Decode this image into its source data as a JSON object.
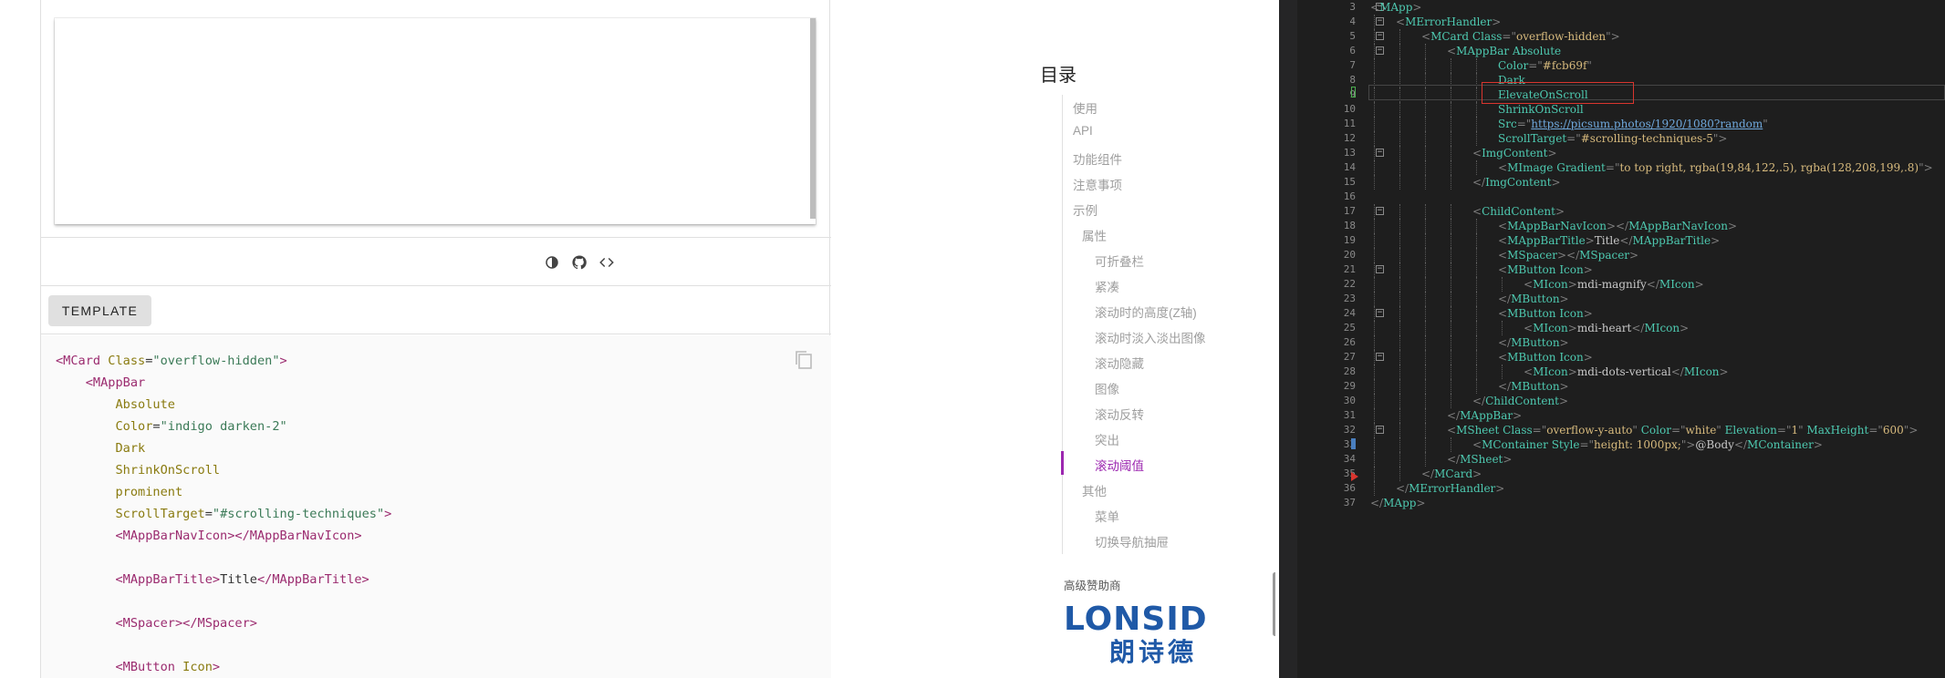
{
  "example": {
    "toolbar_icons": [
      "invert-colors-icon",
      "github-icon",
      "code-icon"
    ],
    "template_tab": "TEMPLATE",
    "code_lines": [
      [
        [
          "t",
          "<MCard "
        ],
        [
          "a",
          "Class"
        ],
        [
          "p",
          "="
        ],
        [
          "s",
          "\"overflow-hidden\""
        ],
        [
          "t",
          ">"
        ]
      ],
      [
        [
          "p",
          "    "
        ],
        [
          "t",
          "<MAppBar"
        ]
      ],
      [
        [
          "p",
          "        "
        ],
        [
          "a",
          "Absolute"
        ]
      ],
      [
        [
          "p",
          "        "
        ],
        [
          "a",
          "Color"
        ],
        [
          "p",
          "="
        ],
        [
          "s",
          "\"indigo darken-2\""
        ]
      ],
      [
        [
          "p",
          "        "
        ],
        [
          "a",
          "Dark"
        ]
      ],
      [
        [
          "p",
          "        "
        ],
        [
          "a",
          "ShrinkOnScroll"
        ]
      ],
      [
        [
          "p",
          "        "
        ],
        [
          "a",
          "prominent"
        ]
      ],
      [
        [
          "p",
          "        "
        ],
        [
          "a",
          "ScrollTarget"
        ],
        [
          "p",
          "="
        ],
        [
          "s",
          "\"#scrolling-techniques\""
        ],
        [
          "t",
          ">"
        ]
      ],
      [
        [
          "p",
          "        "
        ],
        [
          "t",
          "<MAppBarNavIcon></MAppBarNavIcon>"
        ]
      ],
      [
        [
          "p",
          ""
        ]
      ],
      [
        [
          "p",
          "        "
        ],
        [
          "t",
          "<MAppBarTitle>"
        ],
        [
          "p",
          "Title"
        ],
        [
          "t",
          "</MAppBarTitle>"
        ]
      ],
      [
        [
          "p",
          ""
        ]
      ],
      [
        [
          "p",
          "        "
        ],
        [
          "t",
          "<MSpacer></MSpacer>"
        ]
      ],
      [
        [
          "p",
          ""
        ]
      ],
      [
        [
          "p",
          "        "
        ],
        [
          "t",
          "<MButton "
        ],
        [
          "a",
          "Icon"
        ],
        [
          "t",
          ">"
        ]
      ]
    ]
  },
  "toc": {
    "title": "目录",
    "items": [
      {
        "label": "使用",
        "level": 1
      },
      {
        "label": "API",
        "level": 1
      },
      {
        "label": "功能组件",
        "level": 1
      },
      {
        "label": "注意事项",
        "level": 1
      },
      {
        "label": "示例",
        "level": 1
      },
      {
        "label": "属性",
        "level": 2
      },
      {
        "label": "可折叠栏",
        "level": 3
      },
      {
        "label": "紧凑",
        "level": 3
      },
      {
        "label": "滚动时的高度(Z轴)",
        "level": 3
      },
      {
        "label": "滚动时淡入淡出图像",
        "level": 3
      },
      {
        "label": "滚动隐藏",
        "level": 3
      },
      {
        "label": "图像",
        "level": 3
      },
      {
        "label": "滚动反转",
        "level": 3
      },
      {
        "label": "突出",
        "level": 3
      },
      {
        "label": "滚动阈值",
        "level": 3,
        "active": true
      },
      {
        "label": "其他",
        "level": 2
      },
      {
        "label": "菜单",
        "level": 3
      },
      {
        "label": "切换导航抽屉",
        "level": 3
      }
    ],
    "sponsor_label": "高级赞助商",
    "sponsor_logo_text": "LONSID",
    "sponsor_logo_cn": "朗诗德",
    "active_color": "#9c27b0"
  },
  "editor": {
    "line_numbers": [
      3,
      4,
      5,
      6,
      7,
      8,
      9,
      10,
      11,
      12,
      13,
      14,
      15,
      16,
      17,
      18,
      19,
      20,
      21,
      22,
      23,
      24,
      25,
      26,
      27,
      28,
      29,
      30,
      31,
      32,
      33,
      34,
      35,
      36,
      37
    ],
    "fold_lines": [
      3,
      4,
      5,
      6,
      13,
      17,
      21,
      24,
      27,
      32
    ],
    "lines": [
      [
        0,
        [
          [
            "b",
            "<"
          ],
          [
            "t",
            "MApp"
          ],
          [
            "b",
            ">"
          ]
        ]
      ],
      [
        1,
        [
          [
            "b",
            "<"
          ],
          [
            "t",
            "MErrorHandler"
          ],
          [
            "b",
            ">"
          ]
        ]
      ],
      [
        2,
        [
          [
            "b",
            "<"
          ],
          [
            "t",
            "MCard "
          ],
          [
            "at",
            "Class"
          ],
          [
            "b",
            "=\""
          ],
          [
            "x",
            "overflow-hidden"
          ],
          [
            "b",
            "\">"
          ]
        ]
      ],
      [
        3,
        [
          [
            "b",
            "<"
          ],
          [
            "t",
            "MAppBar "
          ],
          [
            "at",
            "Absolute"
          ]
        ]
      ],
      [
        5,
        [
          [
            "at",
            "Color"
          ],
          [
            "b",
            "=\""
          ],
          [
            "x",
            "#fcb69f"
          ],
          [
            "b",
            "\""
          ]
        ]
      ],
      [
        5,
        [
          [
            "at",
            "Dark"
          ]
        ]
      ],
      [
        5,
        [
          [
            "at",
            "ElevateOnScroll"
          ]
        ]
      ],
      [
        5,
        [
          [
            "at",
            "ShrinkOnScroll"
          ]
        ]
      ],
      [
        5,
        [
          [
            "at",
            "Src"
          ],
          [
            "b",
            "=\""
          ],
          [
            "u",
            "https://picsum.photos/1920/1080?random"
          ],
          [
            "b",
            "\""
          ]
        ]
      ],
      [
        5,
        [
          [
            "at",
            "ScrollTarget"
          ],
          [
            "b",
            "=\""
          ],
          [
            "x",
            "#scrolling-techniques-5"
          ],
          [
            "b",
            "\">"
          ]
        ]
      ],
      [
        4,
        [
          [
            "b",
            "<"
          ],
          [
            "t",
            "ImgContent"
          ],
          [
            "b",
            ">"
          ]
        ]
      ],
      [
        5,
        [
          [
            "b",
            "<"
          ],
          [
            "t",
            "MImage "
          ],
          [
            "at",
            "Gradient"
          ],
          [
            "b",
            "=\""
          ],
          [
            "x",
            "to top right, rgba(19,84,122,.5), rgba(128,208,199,.8)"
          ],
          [
            "b",
            "\">"
          ]
        ]
      ],
      [
        4,
        [
          [
            "b",
            "</"
          ],
          [
            "t",
            "ImgContent"
          ],
          [
            "b",
            ">"
          ]
        ]
      ],
      [
        0,
        []
      ],
      [
        4,
        [
          [
            "b",
            "<"
          ],
          [
            "t",
            "ChildContent"
          ],
          [
            "b",
            ">"
          ]
        ]
      ],
      [
        5,
        [
          [
            "b",
            "<"
          ],
          [
            "t",
            "MAppBarNavIcon"
          ],
          [
            "b",
            "></"
          ],
          [
            "t",
            "MAppBarNavIcon"
          ],
          [
            "b",
            ">"
          ]
        ]
      ],
      [
        5,
        [
          [
            "b",
            "<"
          ],
          [
            "t",
            "MAppBarTitle"
          ],
          [
            "b",
            ">"
          ],
          [
            "c",
            "Title"
          ],
          [
            "b",
            "</"
          ],
          [
            "t",
            "MAppBarTitle"
          ],
          [
            "b",
            ">"
          ]
        ]
      ],
      [
        5,
        [
          [
            "b",
            "<"
          ],
          [
            "t",
            "MSpacer"
          ],
          [
            "b",
            "></"
          ],
          [
            "t",
            "MSpacer"
          ],
          [
            "b",
            ">"
          ]
        ]
      ],
      [
        5,
        [
          [
            "b",
            "<"
          ],
          [
            "t",
            "MButton "
          ],
          [
            "at",
            "Icon"
          ],
          [
            "b",
            ">"
          ]
        ]
      ],
      [
        6,
        [
          [
            "b",
            "<"
          ],
          [
            "t",
            "MIcon"
          ],
          [
            "b",
            ">"
          ],
          [
            "c",
            "mdi-magnify"
          ],
          [
            "b",
            "</"
          ],
          [
            "t",
            "MIcon"
          ],
          [
            "b",
            ">"
          ]
        ]
      ],
      [
        5,
        [
          [
            "b",
            "</"
          ],
          [
            "t",
            "MButton"
          ],
          [
            "b",
            ">"
          ]
        ]
      ],
      [
        5,
        [
          [
            "b",
            "<"
          ],
          [
            "t",
            "MButton "
          ],
          [
            "at",
            "Icon"
          ],
          [
            "b",
            ">"
          ]
        ]
      ],
      [
        6,
        [
          [
            "b",
            "<"
          ],
          [
            "t",
            "MIcon"
          ],
          [
            "b",
            ">"
          ],
          [
            "c",
            "mdi-heart"
          ],
          [
            "b",
            "</"
          ],
          [
            "t",
            "MIcon"
          ],
          [
            "b",
            ">"
          ]
        ]
      ],
      [
        5,
        [
          [
            "b",
            "</"
          ],
          [
            "t",
            "MButton"
          ],
          [
            "b",
            ">"
          ]
        ]
      ],
      [
        5,
        [
          [
            "b",
            "<"
          ],
          [
            "t",
            "MButton "
          ],
          [
            "at",
            "Icon"
          ],
          [
            "b",
            ">"
          ]
        ]
      ],
      [
        6,
        [
          [
            "b",
            "<"
          ],
          [
            "t",
            "MIcon"
          ],
          [
            "b",
            ">"
          ],
          [
            "c",
            "mdi-dots-vertical"
          ],
          [
            "b",
            "</"
          ],
          [
            "t",
            "MIcon"
          ],
          [
            "b",
            ">"
          ]
        ]
      ],
      [
        5,
        [
          [
            "b",
            "</"
          ],
          [
            "t",
            "MButton"
          ],
          [
            "b",
            ">"
          ]
        ]
      ],
      [
        4,
        [
          [
            "b",
            "</"
          ],
          [
            "t",
            "ChildContent"
          ],
          [
            "b",
            ">"
          ]
        ]
      ],
      [
        3,
        [
          [
            "b",
            "</"
          ],
          [
            "t",
            "MAppBar"
          ],
          [
            "b",
            ">"
          ]
        ]
      ],
      [
        3,
        [
          [
            "b",
            "<"
          ],
          [
            "t",
            "MSheet "
          ],
          [
            "at",
            "Class"
          ],
          [
            "b",
            "=\""
          ],
          [
            "x",
            "overflow-y-auto"
          ],
          [
            "b",
            "\" "
          ],
          [
            "at",
            "Color"
          ],
          [
            "b",
            "=\""
          ],
          [
            "x",
            "white"
          ],
          [
            "b",
            "\" "
          ],
          [
            "at",
            "Elevation"
          ],
          [
            "b",
            "=\""
          ],
          [
            "x",
            "1"
          ],
          [
            "b",
            "\" "
          ],
          [
            "at",
            "MaxHeight"
          ],
          [
            "b",
            "=\""
          ],
          [
            "x",
            "600"
          ],
          [
            "b",
            "\">"
          ]
        ]
      ],
      [
        4,
        [
          [
            "b",
            "<"
          ],
          [
            "t",
            "MContainer "
          ],
          [
            "at",
            "Style"
          ],
          [
            "b",
            "=\""
          ],
          [
            "x",
            "height: 1000px;"
          ],
          [
            "b",
            "\">"
          ],
          [
            "c",
            "@Body"
          ],
          [
            "b",
            "</"
          ],
          [
            "t",
            "MContainer"
          ],
          [
            "b",
            ">"
          ]
        ]
      ],
      [
        3,
        [
          [
            "b",
            "</"
          ],
          [
            "t",
            "MSheet"
          ],
          [
            "b",
            ">"
          ]
        ]
      ],
      [
        2,
        [
          [
            "b",
            "</"
          ],
          [
            "t",
            "MCard"
          ],
          [
            "b",
            ">"
          ]
        ]
      ],
      [
        1,
        [
          [
            "b",
            "</"
          ],
          [
            "t",
            "MErrorHandler"
          ],
          [
            "b",
            ">"
          ]
        ]
      ],
      [
        0,
        [
          [
            "b",
            "</"
          ],
          [
            "t",
            "MApp"
          ],
          [
            "b",
            ">"
          ]
        ]
      ]
    ]
  }
}
